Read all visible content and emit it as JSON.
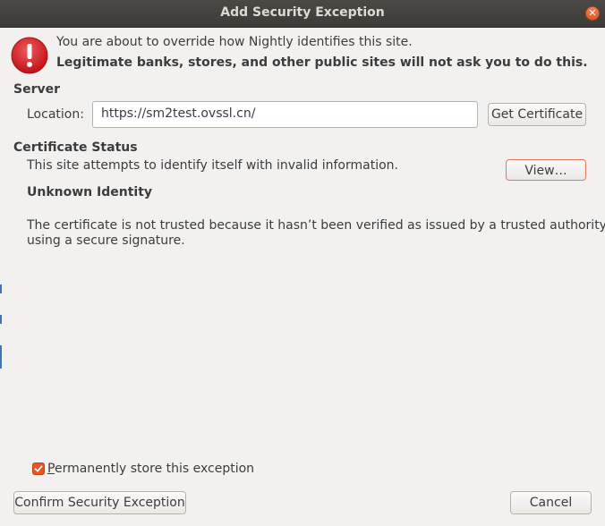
{
  "window": {
    "title": "Add Security Exception",
    "close_icon": "close-icon"
  },
  "warning": {
    "icon": "warning-icon",
    "line1": "You are about to override how Nightly identifies this site.",
    "line2": "Legitimate banks, stores, and other public sites will not ask you to do this."
  },
  "server": {
    "heading": "Server",
    "location_label": "Location:",
    "location_value": "https://sm2test.ovssl.cn/",
    "get_certificate_label": "Get Certificate"
  },
  "certificate_status": {
    "heading": "Certificate Status",
    "description": "This site attempts to identify itself with invalid information.",
    "view_label": "View…",
    "identity_heading": "Unknown Identity",
    "detail_line1": "The certificate is not trusted because it hasn’t been verified as issued by a trusted authority",
    "detail_line2": "using a secure signature."
  },
  "footer": {
    "permanent_label": "Permanently store this exception",
    "permanent_checked": true,
    "confirm_label": "Confirm Security Exception",
    "cancel_label": "Cancel"
  },
  "colors": {
    "accent": "#e95420",
    "warning_red": "#d6262b",
    "titlebar": "#3c3b37"
  }
}
